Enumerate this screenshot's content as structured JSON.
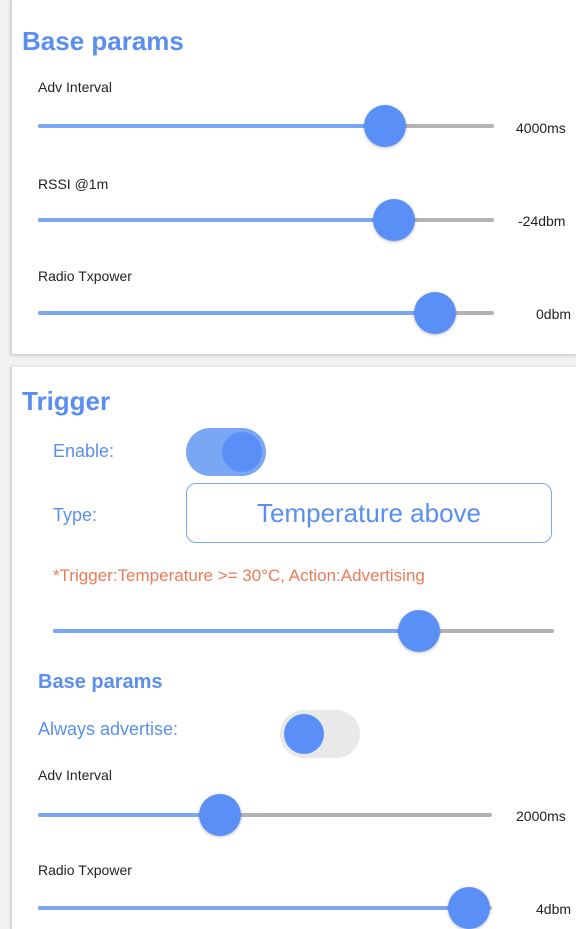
{
  "base_params": {
    "title": "Base params",
    "adv_interval": {
      "label": "Adv Interval",
      "value_text": "4000ms",
      "fraction": 0.76
    },
    "rssi": {
      "label": "RSSI @1m",
      "value_text": "-24dbm",
      "fraction": 0.78
    },
    "radio_txpower": {
      "label": "Radio Txpower",
      "value_text": "0dbm",
      "fraction": 0.87
    }
  },
  "trigger": {
    "title": "Trigger",
    "enable": {
      "label": "Enable:",
      "on": true
    },
    "type": {
      "label": "Type:",
      "value": "Temperature above"
    },
    "note": "*Trigger:Temperature >= 30°C, Action:Advertising",
    "threshold_fraction": 0.73,
    "base_params": {
      "title": "Base params",
      "always_advertise": {
        "label": "Always advertise:",
        "on": false
      },
      "adv_interval": {
        "label": "Adv Interval",
        "value_text": "2000ms",
        "fraction": 0.4
      },
      "radio_txpower": {
        "label": "Radio Txpower",
        "value_text": "4dbm",
        "fraction": 0.95
      }
    }
  },
  "colors": {
    "accent": "#5a8ff0",
    "slider_active": "#7aa7f3",
    "slider_inactive": "#b3b3b3",
    "thumb": "#5a8ff7",
    "warning_text": "#ec7b58"
  }
}
